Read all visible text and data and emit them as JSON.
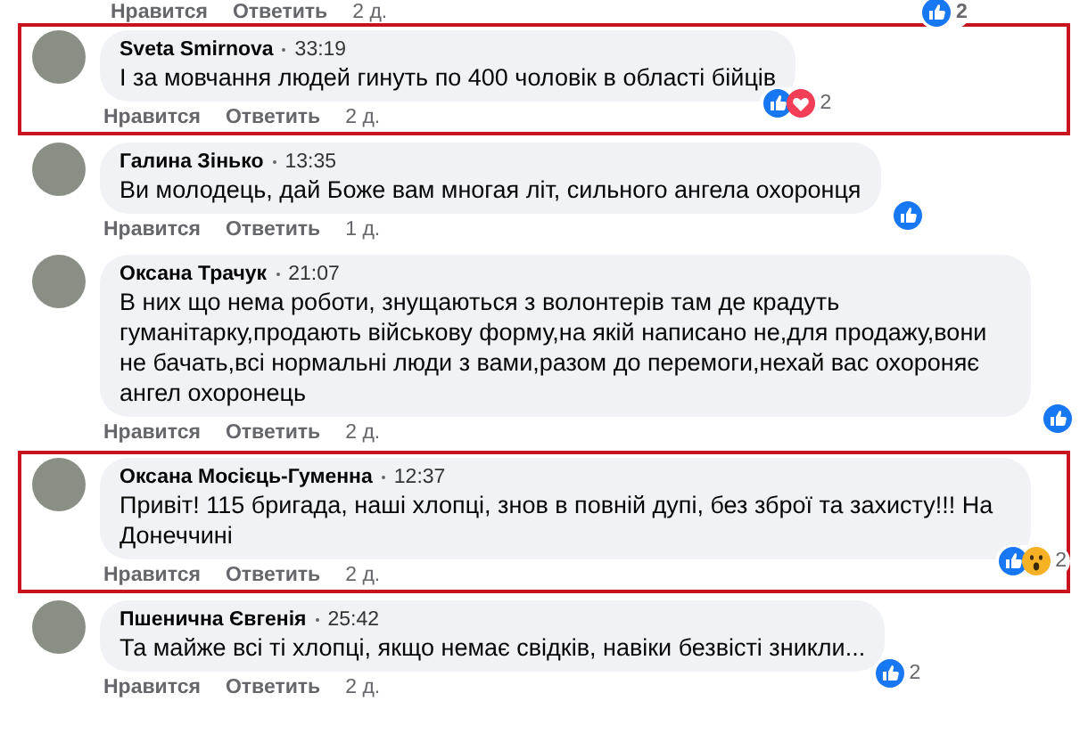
{
  "previous_actions": {
    "like": "Нравится",
    "reply": "Ответить",
    "age": "2 д.",
    "reactions": [
      {
        "kind": "like"
      }
    ],
    "count": "2"
  },
  "comments": [
    {
      "author": "Sveta Smirnova",
      "time": "33:19",
      "text": "І за мовчання людей гинуть по 400 чоловік в області бійців",
      "highlighted": true,
      "like": "Нравится",
      "reply": "Ответить",
      "age": "2 д.",
      "reactions": [
        {
          "kind": "like"
        },
        {
          "kind": "love"
        }
      ],
      "count": "2"
    },
    {
      "author": "Галина Зінько",
      "time": "13:35",
      "text": "Ви молодець, дай Боже вам многая літ, сильного ангела охоронця",
      "highlighted": false,
      "like": "Нравится",
      "reply": "Ответить",
      "age": "1 д.",
      "reactions": [
        {
          "kind": "like"
        }
      ]
    },
    {
      "author": "Оксана Трачук",
      "time": "21:07",
      "text": "В них що нема роботи, знущаються з волонтерів там де крадуть гуманітарку,продають військову форму,на якій написано не,для продажу,вони не бачать,всі нормальні люди з вами,разом до перемоги,нехай вас охороняє ангел охоронець",
      "highlighted": false,
      "like": "Нравится",
      "reply": "Ответить",
      "age": "2 д.",
      "reactions": [
        {
          "kind": "like"
        }
      ]
    },
    {
      "author": "Оксана Мосієць-Гуменна",
      "time": "12:37",
      "text": "Привіт! 115 бригада, наші хлопці, знов в повній дупі, без зброї та захисту!!! На Донеччині",
      "highlighted": true,
      "like": "Нравится",
      "reply": "Ответить",
      "age": "2 д.",
      "reactions": [
        {
          "kind": "like"
        },
        {
          "kind": "wow"
        }
      ],
      "count": "2"
    },
    {
      "author": "Пшенична Євгенія",
      "time": "25:42",
      "text": "Та майже всі ті хлопці, якщо немає свідків, навіки безвісті зникли...",
      "highlighted": false,
      "like": "Нравится",
      "reply": "Ответить",
      "age": "2 д.",
      "reactions": [
        {
          "kind": "like"
        }
      ],
      "count": "2"
    }
  ]
}
